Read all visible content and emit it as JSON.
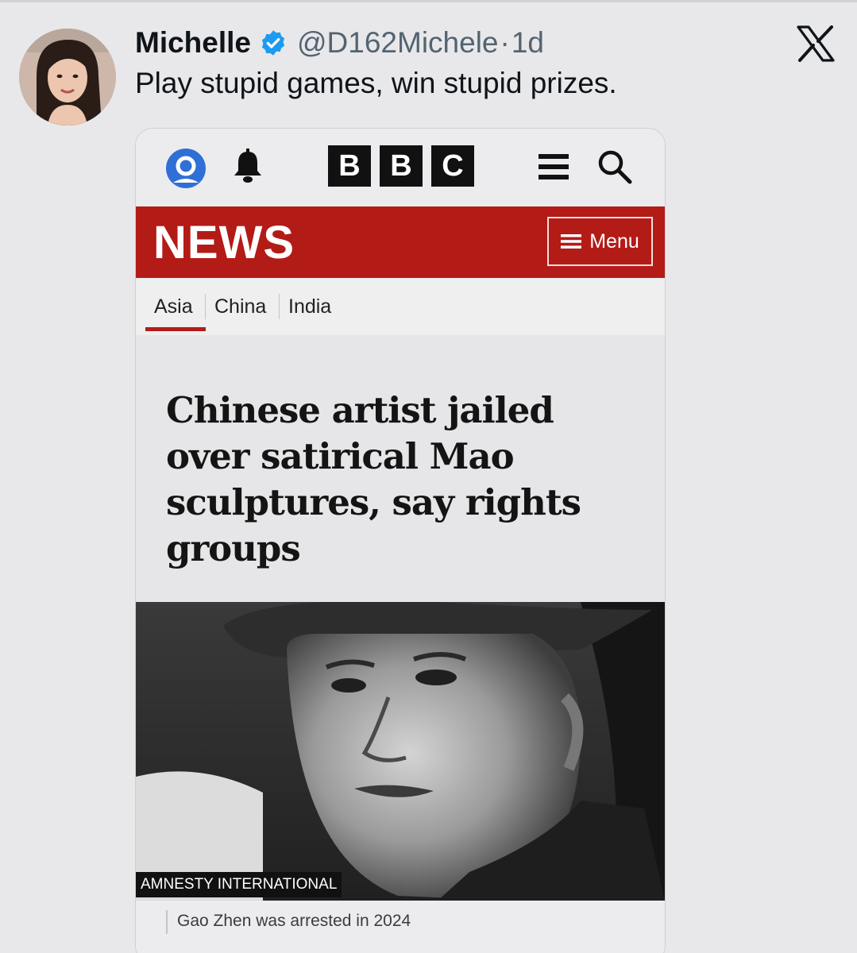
{
  "tweet": {
    "display_name": "Michelle",
    "verified_icon": "verified-badge-icon",
    "handle": "@D162Michele",
    "separator": "·",
    "time": "1d",
    "text": "Play stupid games, win stupid prizes.",
    "platform_icon": "x-logo-icon"
  },
  "bbc": {
    "logo_letters": [
      "B",
      "B",
      "C"
    ],
    "icons": [
      "account-icon",
      "bell-icon",
      "hamburger-icon",
      "search-icon"
    ],
    "news_label": "NEWS",
    "menu_label": "Menu",
    "nav": [
      "Asia",
      "China",
      "India"
    ],
    "active_nav": "Asia",
    "headline": "Chinese artist jailed over satirical Mao sculptures, say rights groups",
    "photo_credit": "AMNESTY INTERNATIONAL",
    "caption": "Gao Zhen was arrested in 2024",
    "colors": {
      "news_red": "#b31b17",
      "account_blue": "#2f6fd6",
      "verified_blue": "#1d9bf0"
    }
  }
}
